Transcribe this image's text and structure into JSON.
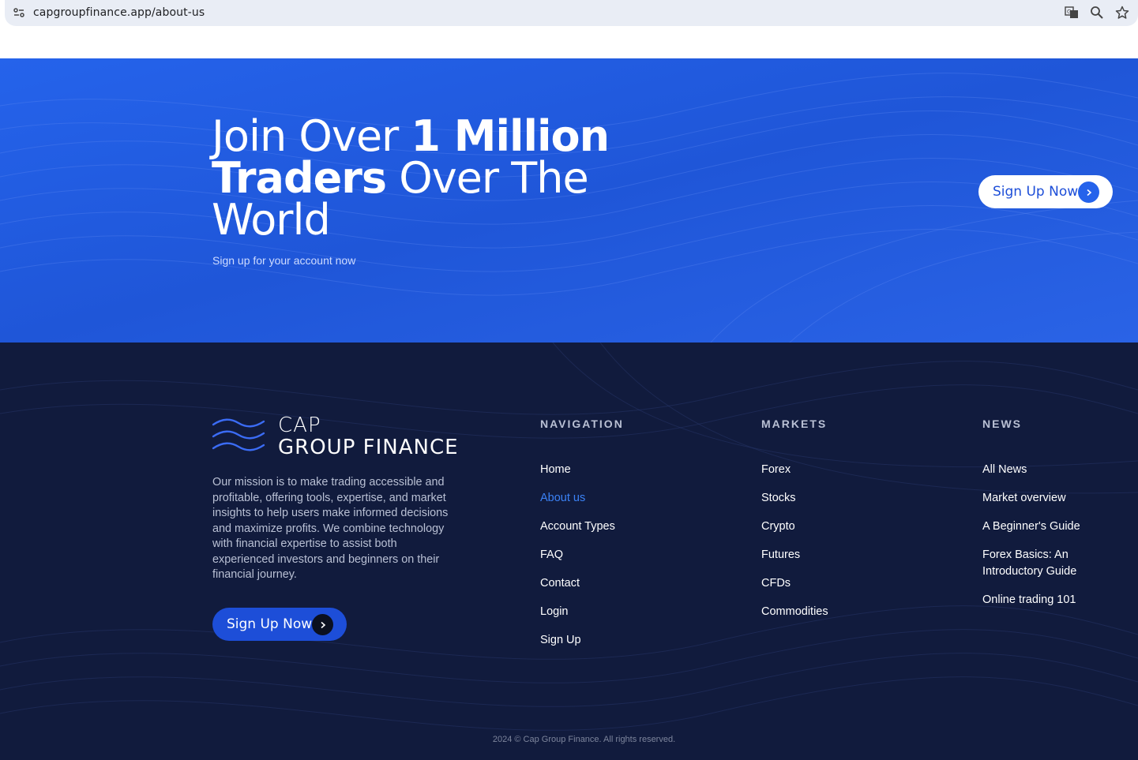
{
  "browser": {
    "url": "capgroupfinance.app/about-us"
  },
  "hero": {
    "title_part1": "Join Over ",
    "title_bold1": "1 Million",
    "title_bold2": "Traders",
    "title_part2": " Over The",
    "title_part3": "World",
    "subtitle": "Sign up for your account now",
    "signup_label": "Sign Up Now"
  },
  "footer": {
    "logo_line1": "CAP",
    "logo_line2": "GROUP FINANCE",
    "mission": "Our mission is to make trading accessible and profitable, offering tools, expertise, and market insights to help users make informed decisions and maximize profits. We combine technology with financial expertise to assist both experienced investors and beginners on their financial journey.",
    "signup_label": "Sign Up Now",
    "navigation": {
      "heading": "NAVIGATION",
      "items": [
        "Home",
        "About us",
        "Account Types",
        "FAQ",
        "Contact",
        "Login",
        "Sign Up"
      ]
    },
    "markets": {
      "heading": "MARKETS",
      "items": [
        "Forex",
        "Stocks",
        "Crypto",
        "Futures",
        "CFDs",
        "Commodities"
      ]
    },
    "news": {
      "heading": "NEWS",
      "items": [
        "All News",
        "Market overview",
        "A Beginner's Guide",
        "Forex Basics: An Introductory Guide",
        "Online trading 101"
      ]
    },
    "copyright": "2024 © Cap Group Finance. All rights reserved."
  },
  "colors": {
    "hero_blue": "#2563eb",
    "footer_navy": "#111b3d",
    "active_link": "#3b82f6"
  }
}
